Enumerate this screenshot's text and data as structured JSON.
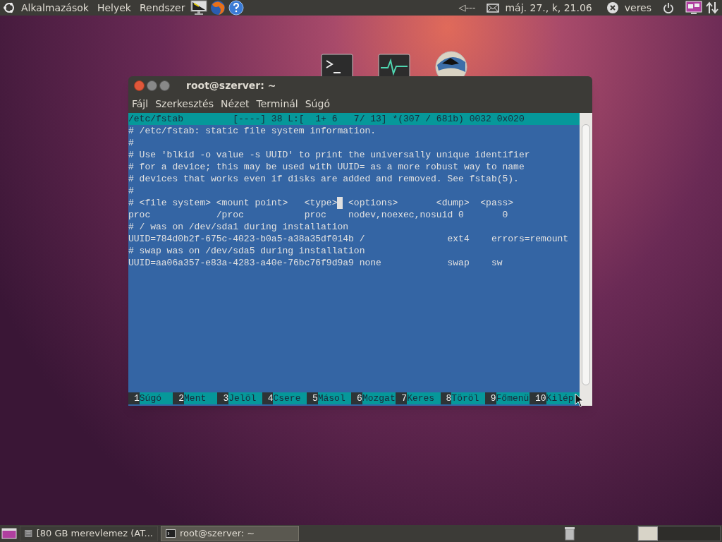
{
  "top_panel": {
    "menus": [
      "Alkalmazások",
      "Helyek",
      "Rendszer"
    ],
    "clock": "máj. 27., k, 21.06",
    "volume": "◁---",
    "user": "veres"
  },
  "window": {
    "title": "root@szerver: ~",
    "menu": [
      "Fájl",
      "Szerkesztés",
      "Nézet",
      "Terminál",
      "Súgó"
    ]
  },
  "editor": {
    "status_line": "/etc/fstab         [----] 38 L:[  1+ 6   7/ 13] *(307 / 681b) 0032 0x020",
    "lines": [
      {
        "text": "# /etc/fstab: static file system information."
      },
      {
        "text": "#"
      },
      {
        "text": "# Use 'blkid -o value -s UUID' to print the universally unique identifier"
      },
      {
        "text": "# for a device; this may be used with UUID= as a more robust way to name"
      },
      {
        "text": "# devices that works even if disks are added and removed. See fstab(5)."
      },
      {
        "text": "#"
      },
      {
        "text": "# <file system> <mount point>   <type>",
        "cursor": true,
        "rest": " <options>       <dump>  <pass>"
      },
      {
        "text": "proc            /proc           proc    nodev,noexec,nosuid 0       0"
      },
      {
        "text": "# / was on /dev/sda1 during installation"
      },
      {
        "text": "UUID=784d0b2f-675c-4023-b0a5-a38a35df014b /               ext4    errors=remount"
      },
      {
        "text": "# swap was on /dev/sda5 during installation"
      },
      {
        "text": "UUID=aa06a357-e83a-4283-a40e-76bc76f9d9a9 none            swap    sw"
      }
    ],
    "function_keys": [
      {
        "number": "1",
        "label": "Súgó"
      },
      {
        "number": "2",
        "label": "Ment"
      },
      {
        "number": "3",
        "label": "Jelöl"
      },
      {
        "number": "4",
        "label": "Csere"
      },
      {
        "number": "5",
        "label": "Másol"
      },
      {
        "number": "6",
        "label": "Mozgat"
      },
      {
        "number": "7",
        "label": "Keres"
      },
      {
        "number": "8",
        "label": "Töröl"
      },
      {
        "number": "9",
        "label": "Főmenü"
      },
      {
        "number": "10",
        "label": "Kilép"
      }
    ]
  },
  "taskbar": {
    "items": [
      {
        "label": "[80 GB merevlemez (AT...",
        "selected": false
      },
      {
        "label": "root@szerver: ~",
        "selected": true
      }
    ]
  }
}
